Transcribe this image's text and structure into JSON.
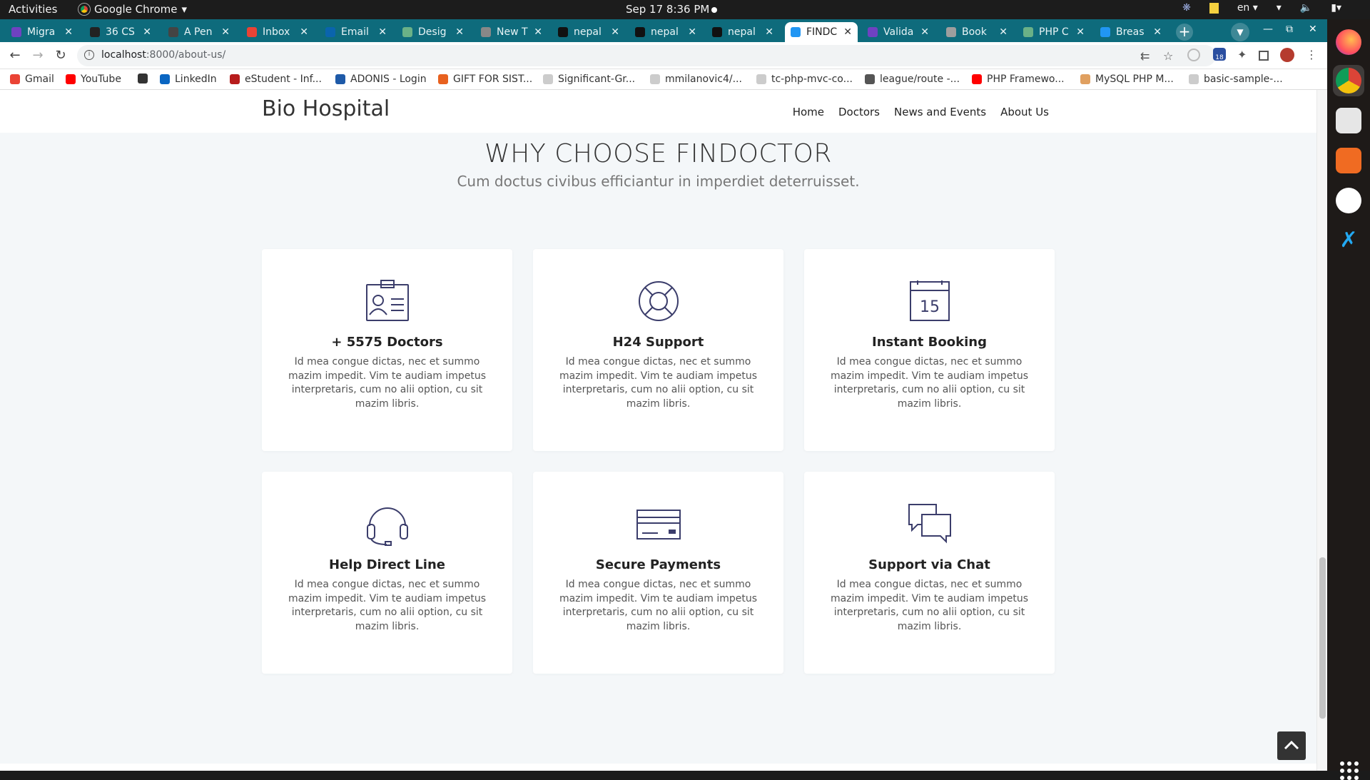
{
  "system_bar": {
    "activities": "Activities",
    "app_name": "Google Chrome",
    "clock": "Sep 17  8:36 PM",
    "language": "en"
  },
  "tabs": [
    {
      "label": "Migra",
      "fav_color": "#6f42c1"
    },
    {
      "label": "36 CS",
      "fav_color": "#222222"
    },
    {
      "label": "A Pen",
      "fav_color": "#444444"
    },
    {
      "label": "Inbox",
      "fav_color": "#ea4335"
    },
    {
      "label": "Email",
      "fav_color": "#0a64ad"
    },
    {
      "label": "Desig",
      "fav_color": "#6ab187"
    },
    {
      "label": "New T",
      "fav_color": "#888888"
    },
    {
      "label": "nepal",
      "fav_color": "#111111"
    },
    {
      "label": "nepal",
      "fav_color": "#111111"
    },
    {
      "label": "nepal",
      "fav_color": "#111111"
    },
    {
      "label": "FINDC",
      "fav_color": "#2196f3",
      "active": true
    },
    {
      "label": "Valida",
      "fav_color": "#6f42c1"
    },
    {
      "label": "Book",
      "fav_color": "#9e9e9e"
    },
    {
      "label": "PHP C",
      "fav_color": "#6ab187"
    },
    {
      "label": "Breas",
      "fav_color": "#2196f3"
    }
  ],
  "address_bar": {
    "host": "localhost",
    "path": ":8000/about-us/"
  },
  "bookmarks": [
    {
      "label": "Gmail",
      "fav_color": "#ea4335"
    },
    {
      "label": "YouTube",
      "fav_color": "#ff0000"
    },
    {
      "label": "",
      "fav_color": "#333333"
    },
    {
      "label": "LinkedIn",
      "fav_color": "#0a66c2"
    },
    {
      "label": "eStudent - Inf...",
      "fav_color": "#b71c1c"
    },
    {
      "label": "ADONIS - Login",
      "fav_color": "#1e5aa8"
    },
    {
      "label": "GIFT FOR SIST...",
      "fav_color": "#e8611f"
    },
    {
      "label": "Significant-Gr...",
      "fav_color": "#cccccc"
    },
    {
      "label": "mmilanovic4/...",
      "fav_color": "#cccccc"
    },
    {
      "label": "tc-php-mvc-co...",
      "fav_color": "#cccccc"
    },
    {
      "label": "league/route -...",
      "fav_color": "#555555"
    },
    {
      "label": "PHP Framewo...",
      "fav_color": "#ff0000"
    },
    {
      "label": "MySQL PHP M...",
      "fav_color": "#e0a060"
    },
    {
      "label": "basic-sample-...",
      "fav_color": "#cccccc"
    }
  ],
  "site": {
    "brand": "Bio Hospital",
    "nav": [
      "Home",
      "Doctors",
      "News and Events",
      "About Us"
    ],
    "section_title": "WHY CHOOSE FINDOCTOR",
    "section_subtitle": "Cum doctus civibus efficiantur in imperdiet deterruisset.",
    "features": [
      {
        "title": "+ 5575 Doctors",
        "icon": "id-card-icon",
        "text": "Id mea congue dictas, nec et summo mazim impedit. Vim te audiam impetus interpretaris, cum no alii option, cu sit mazim libris."
      },
      {
        "title": "H24 Support",
        "icon": "lifebuoy-icon",
        "text": "Id mea congue dictas, nec et summo mazim impedit. Vim te audiam impetus interpretaris, cum no alii option, cu sit mazim libris."
      },
      {
        "title": "Instant Booking",
        "icon": "calendar-icon",
        "text": "Id mea congue dictas, nec et summo mazim impedit. Vim te audiam impetus interpretaris, cum no alii option, cu sit mazim libris."
      },
      {
        "title": "Help Direct Line",
        "icon": "headset-icon",
        "text": "Id mea congue dictas, nec et summo mazim impedit. Vim te audiam impetus interpretaris, cum no alii option, cu sit mazim libris."
      },
      {
        "title": "Secure Payments",
        "icon": "credit-card-icon",
        "text": "Id mea congue dictas, nec et summo mazim impedit. Vim te audiam impetus interpretaris, cum no alii option, cu sit mazim libris."
      },
      {
        "title": "Support via Chat",
        "icon": "chat-bubbles-icon",
        "text": "Id mea congue dictas, nec et summo mazim impedit. Vim te audiam impetus interpretaris, cum no alii option, cu sit mazim libris."
      }
    ],
    "calendar_day": "15"
  },
  "colors": {
    "tabstrip": "#0e6b7c",
    "icon_stroke": "#3b3d6b",
    "page_bg": "#f4f7f9"
  }
}
